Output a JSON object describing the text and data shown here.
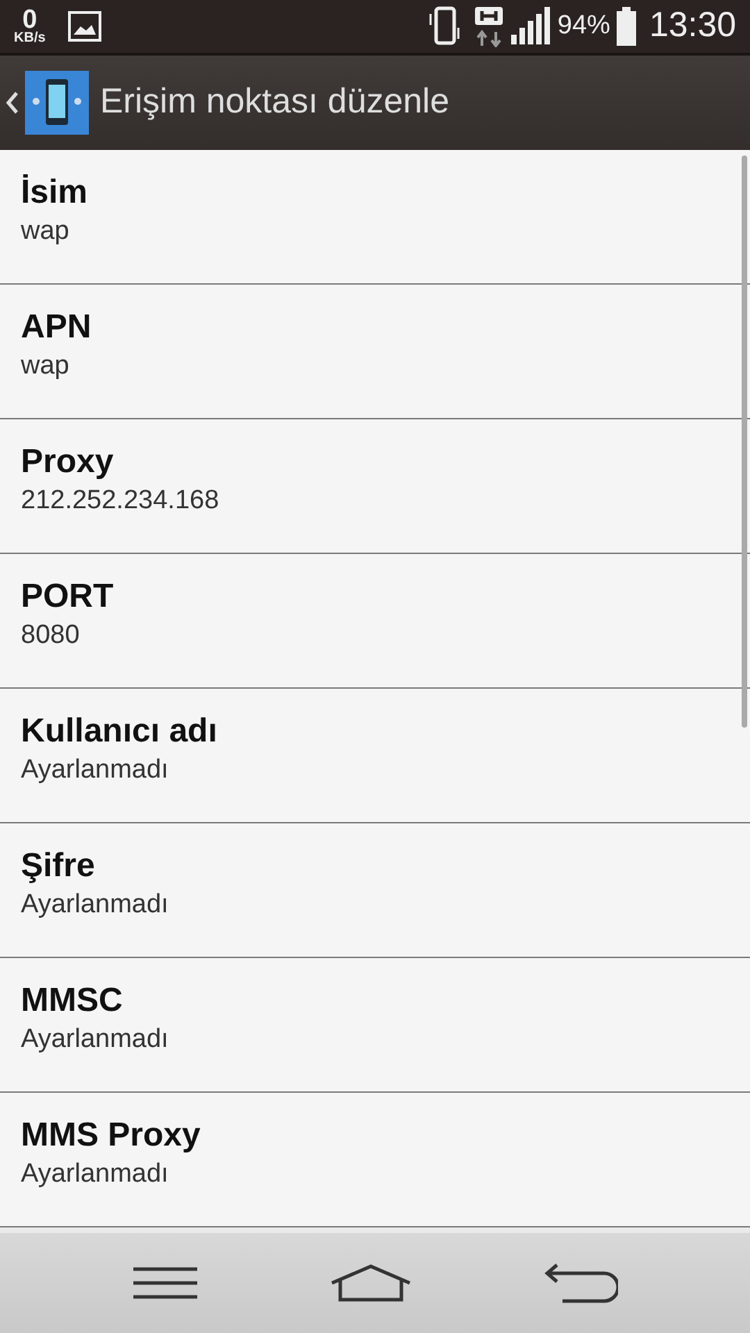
{
  "status_bar": {
    "speed_value": "0",
    "speed_unit": "KB/s",
    "battery": "94%",
    "time": "13:30"
  },
  "action_bar": {
    "title": "Erişim noktası düzenle"
  },
  "settings": [
    {
      "title": "İsim",
      "value": "wap"
    },
    {
      "title": "APN",
      "value": "wap"
    },
    {
      "title": "Proxy",
      "value": "212.252.234.168"
    },
    {
      "title": "PORT",
      "value": "8080"
    },
    {
      "title": "Kullanıcı adı",
      "value": "Ayarlanmadı"
    },
    {
      "title": "Şifre",
      "value": "Ayarlanmadı"
    },
    {
      "title": "MMSC",
      "value": "Ayarlanmadı"
    },
    {
      "title": "MMS Proxy",
      "value": "Ayarlanmadı"
    }
  ]
}
